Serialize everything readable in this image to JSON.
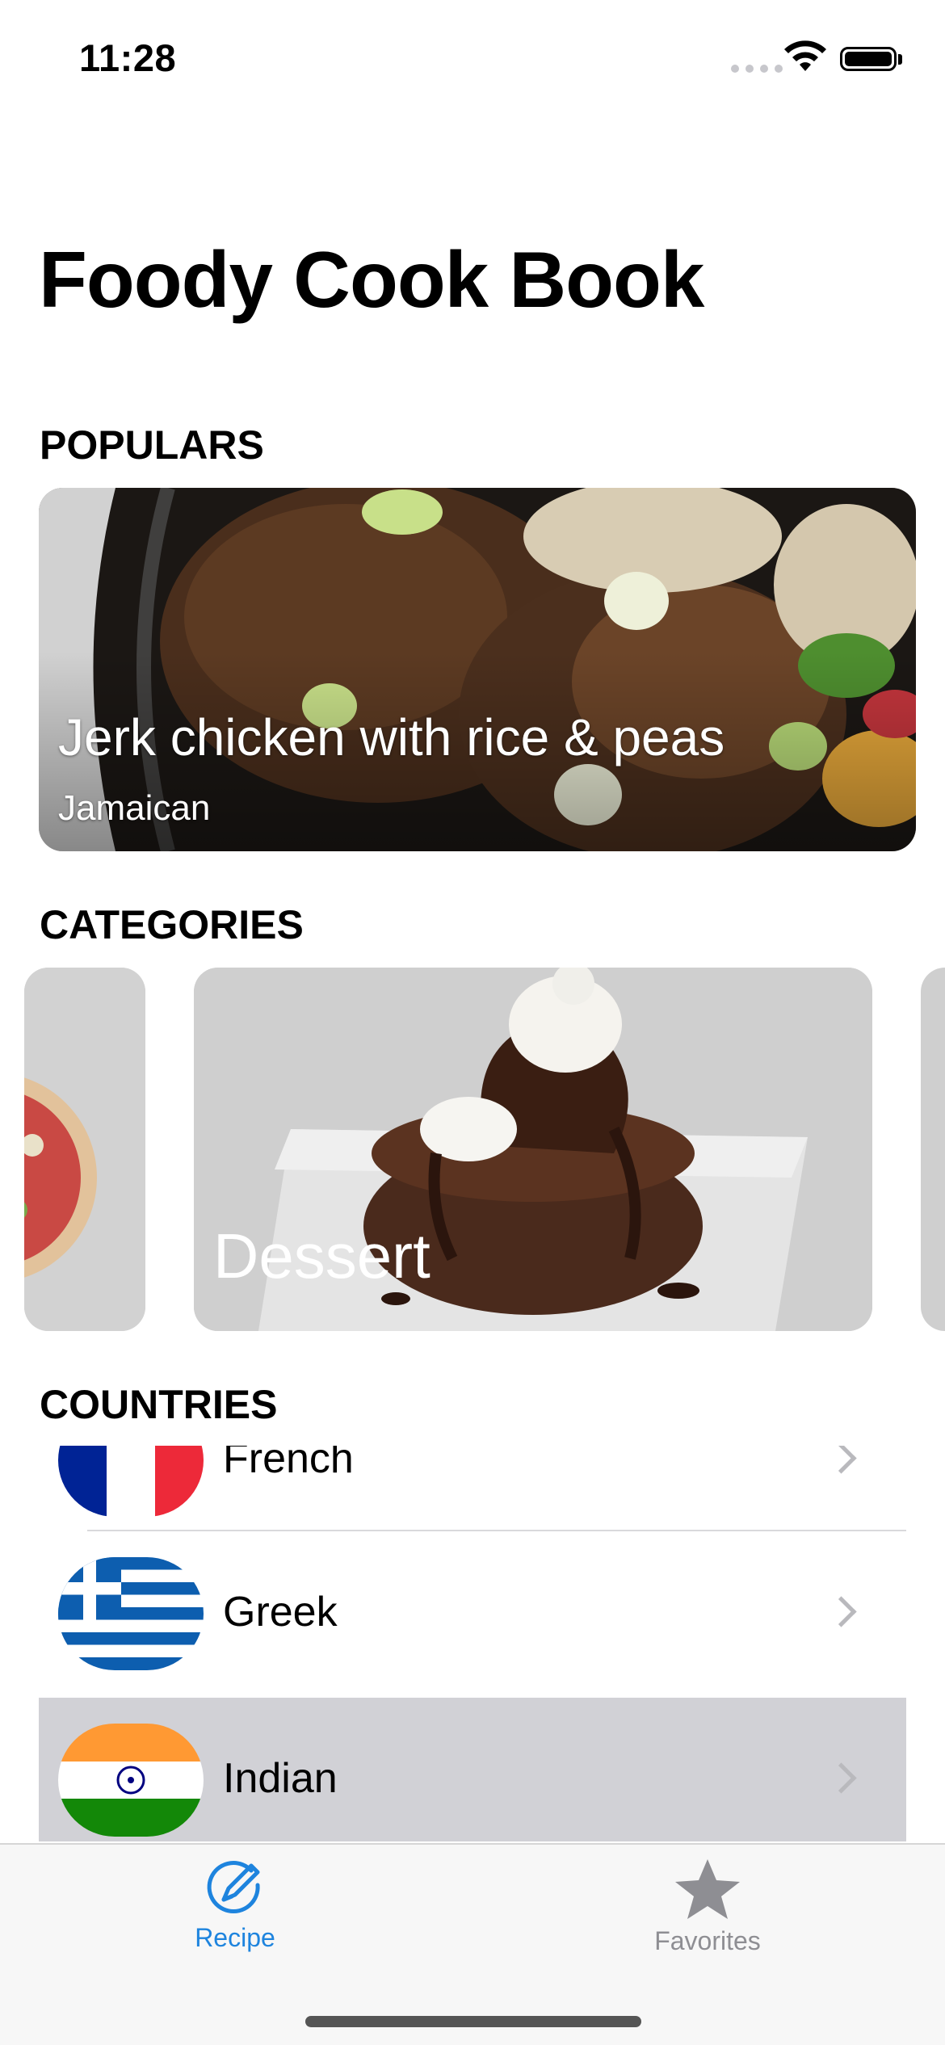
{
  "status_bar": {
    "time": "11:28"
  },
  "app": {
    "title": "Foody Cook Book"
  },
  "populars": {
    "section_title": "POPULARS",
    "items": [
      {
        "name": "Jerk chicken with rice & peas",
        "country": "Jamaican"
      }
    ]
  },
  "categories": {
    "section_title": "CATEGORIES",
    "items": [
      {
        "name": "Dessert"
      }
    ]
  },
  "countries": {
    "section_title": "COUNTRIES",
    "items": [
      {
        "name": "French",
        "selected": false
      },
      {
        "name": "Greek",
        "selected": false
      },
      {
        "name": "Indian",
        "selected": true
      }
    ]
  },
  "tab_bar": {
    "tabs": [
      {
        "label": "Recipe",
        "icon": "recipe-pencil-icon",
        "active": true,
        "color": "#1e84de"
      },
      {
        "label": "Favorites",
        "icon": "star-icon",
        "active": false,
        "color": "#8e8e93"
      }
    ]
  }
}
